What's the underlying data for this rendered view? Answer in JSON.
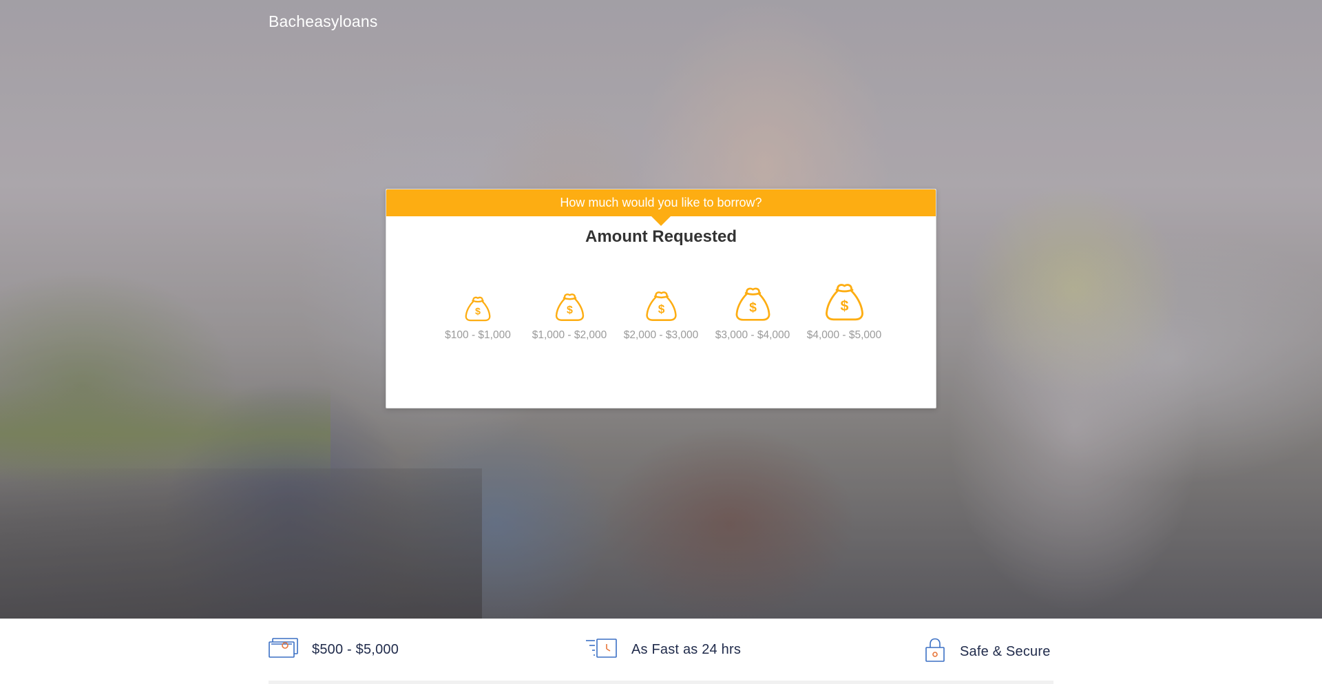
{
  "brand": {
    "name": "Bacheasyloans"
  },
  "card": {
    "header": "How much would you like to borrow?",
    "title": "Amount Requested",
    "options": [
      {
        "label": "$100 - $1,000",
        "icon": "money-bag-icon"
      },
      {
        "label": "$1,000 - $2,000",
        "icon": "money-bag-icon"
      },
      {
        "label": "$2,000 - $3,000",
        "icon": "money-bag-icon"
      },
      {
        "label": "$3,000 - $4,000",
        "icon": "money-bag-icon"
      },
      {
        "label": "$4,000 - $5,000",
        "icon": "money-bag-icon"
      }
    ]
  },
  "features": [
    {
      "label": "$500 - $5,000",
      "icon": "cash-icon"
    },
    {
      "label": "As Fast as 24 hrs",
      "icon": "fast-clock-icon"
    },
    {
      "label": "Safe & Secure",
      "icon": "padlock-icon"
    }
  ],
  "colors": {
    "accent": "#fdad12",
    "feature_text": "#1f2a4a",
    "icon_blue": "#3a6fc4",
    "icon_orange": "#e8763a"
  }
}
